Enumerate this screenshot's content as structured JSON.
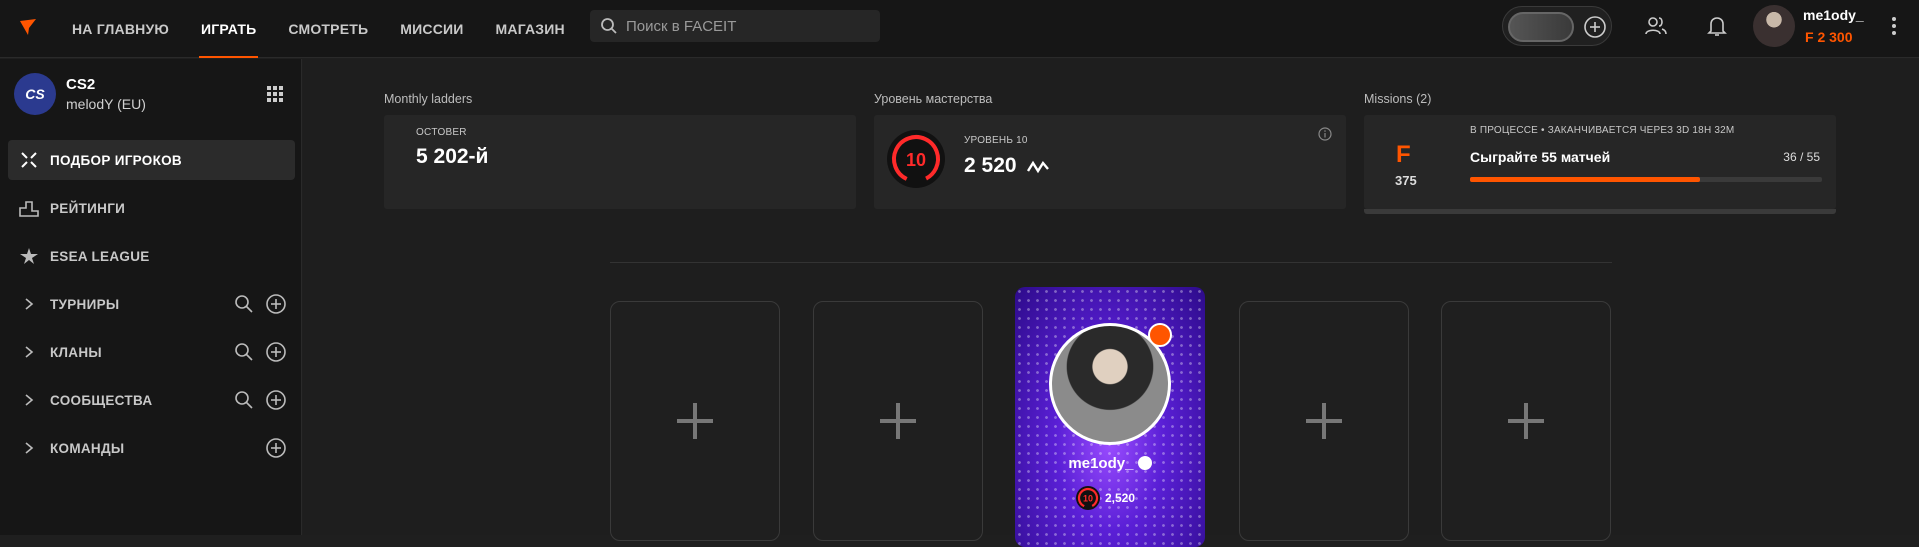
{
  "nav": {
    "items": [
      {
        "label": "НА ГЛАВНУЮ",
        "active": false
      },
      {
        "label": "ИГРАТЬ",
        "active": true
      },
      {
        "label": "СМОТРЕТЬ",
        "active": false
      },
      {
        "label": "МИССИИ",
        "active": false
      },
      {
        "label": "МАГАЗИН",
        "active": false
      }
    ]
  },
  "search": {
    "placeholder": "Поиск в FACEIT"
  },
  "user": {
    "name": "me1ody_",
    "points": "2 300"
  },
  "sidebar": {
    "game_logo": "CS",
    "game_title": "CS2",
    "game_sub": "melodY (EU)",
    "items": [
      {
        "label": "ПОДБОР ИГРОКОВ"
      },
      {
        "label": "РЕЙТИНГИ"
      },
      {
        "label": "ESEA LEAGUE"
      },
      {
        "label": "ТУРНИРЫ"
      },
      {
        "label": "КЛАНЫ"
      },
      {
        "label": "СООБЩЕСТВА"
      },
      {
        "label": "КОМАНДЫ"
      }
    ]
  },
  "ladders": {
    "label": "Monthly ladders",
    "month": "OCTOBER",
    "rank": "5 202-й"
  },
  "mastery": {
    "label": "Уровень мастерства",
    "level_text": "УРОВЕНЬ 10",
    "level": "10",
    "elo": "2 520"
  },
  "missions": {
    "label": "Missions (2)",
    "status": "В ПРОЦЕССЕ • ЗАКАНЧИВАЕТСЯ ЧЕРЕЗ 3D 18H 32M",
    "title": "Сыграйте 55 матчей",
    "progress_text": "36 / 55",
    "progress_fraction": 0.6545,
    "points": "375",
    "f_glyph": "F"
  },
  "player_card": {
    "name": "me1ody_",
    "level": "10",
    "elo": "2,520"
  },
  "colors": {
    "accent": "#ff5500",
    "card_purple": "#5a1fd6"
  }
}
